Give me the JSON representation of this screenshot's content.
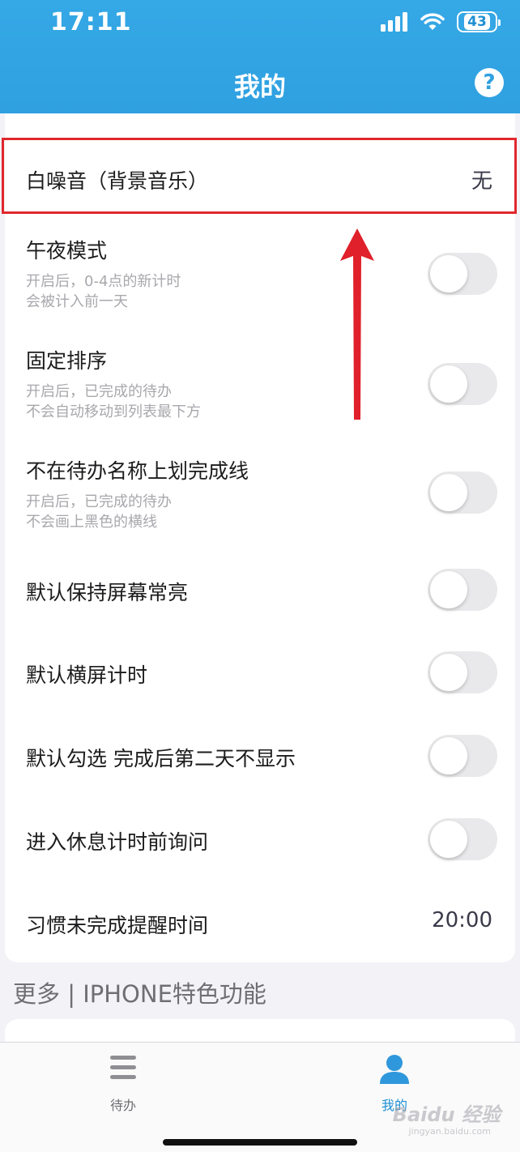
{
  "status_bar": {
    "time": "17:11",
    "battery": "43"
  },
  "header": {
    "title": "我的",
    "help_glyph": "?"
  },
  "settings": [
    {
      "title": "白噪音（背景音乐）",
      "value": "无"
    },
    {
      "title": "午夜模式",
      "sub1": "开启后，0-4点的新计时",
      "sub2": "会被计入前一天",
      "toggle": false
    },
    {
      "title": "固定排序",
      "sub1": "开启后，已完成的待办",
      "sub2": "不会自动移动到列表最下方",
      "toggle": false
    },
    {
      "title": "不在待办名称上划完成线",
      "sub1": "开启后，已完成的待办",
      "sub2": "不会画上黑色的横线",
      "toggle": false
    },
    {
      "title": "默认保持屏幕常亮",
      "toggle": false
    },
    {
      "title": "默认横屏计时",
      "toggle": false
    },
    {
      "title": "默认勾选 完成后第二天不显示",
      "toggle": false
    },
    {
      "title": "进入休息计时前询问",
      "toggle": false
    },
    {
      "title": "习惯未完成提醒时间",
      "value": "20:00"
    }
  ],
  "section2": {
    "title": "更多 | IPHONE特色功能"
  },
  "tabbar": {
    "tabs": [
      {
        "label": "待办",
        "icon": "list-icon",
        "active": false
      },
      {
        "label": "我的",
        "icon": "person-icon",
        "active": true
      }
    ]
  },
  "watermark": {
    "brand": "Baidu 经验",
    "url": "jingyan.baidu.com"
  },
  "colors": {
    "header": "#2fa0e0",
    "accent": "#1e8fd3",
    "highlight": "#e0282e",
    "toggle_off": "#e9e9eb"
  }
}
